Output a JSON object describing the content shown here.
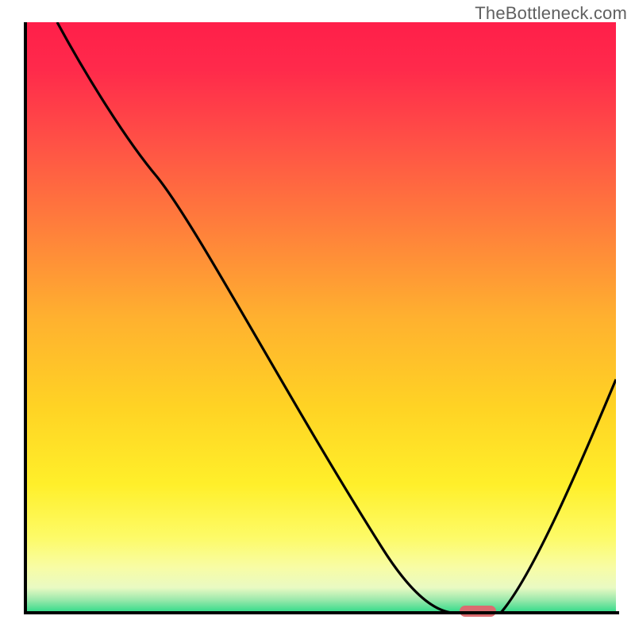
{
  "watermark": "TheBottleneck.com",
  "colors": {
    "gradient_top": "#ff1f4a",
    "gradient_upper_mid": "#ff803b",
    "gradient_mid": "#ffd324",
    "gradient_lower_mid": "#fdfb67",
    "gradient_bottom": "#1fd884",
    "axis": "#000000",
    "curve": "#000000",
    "marker": "#db6c70"
  },
  "chart_data": {
    "type": "line",
    "title": "",
    "xlabel": "",
    "ylabel": "",
    "xlim": [
      0,
      100
    ],
    "ylim": [
      0,
      100
    ],
    "grid": false,
    "legend": false,
    "annotations": [
      {
        "text": "TheBottleneck.com",
        "position": "top-right"
      }
    ],
    "series": [
      {
        "name": "bottleneck-curve",
        "x": [
          5,
          12,
          22,
          30,
          40,
          50,
          60,
          68,
          74,
          80,
          85,
          92,
          100
        ],
        "y": [
          100,
          89,
          74,
          63,
          48,
          33,
          18,
          8,
          1,
          0,
          5,
          20,
          40
        ]
      }
    ],
    "marker": {
      "name": "optimal-point",
      "x_range": [
        74,
        80
      ],
      "y": 0,
      "color": "#db6c70",
      "shape": "pill"
    },
    "background_gradient": {
      "direction": "vertical",
      "stops": [
        {
          "pos": 0.0,
          "color": "#ff1f4a"
        },
        {
          "pos": 0.35,
          "color": "#ff803b"
        },
        {
          "pos": 0.65,
          "color": "#ffd324"
        },
        {
          "pos": 0.87,
          "color": "#fdfb67"
        },
        {
          "pos": 1.0,
          "color": "#1fd884"
        }
      ]
    }
  }
}
